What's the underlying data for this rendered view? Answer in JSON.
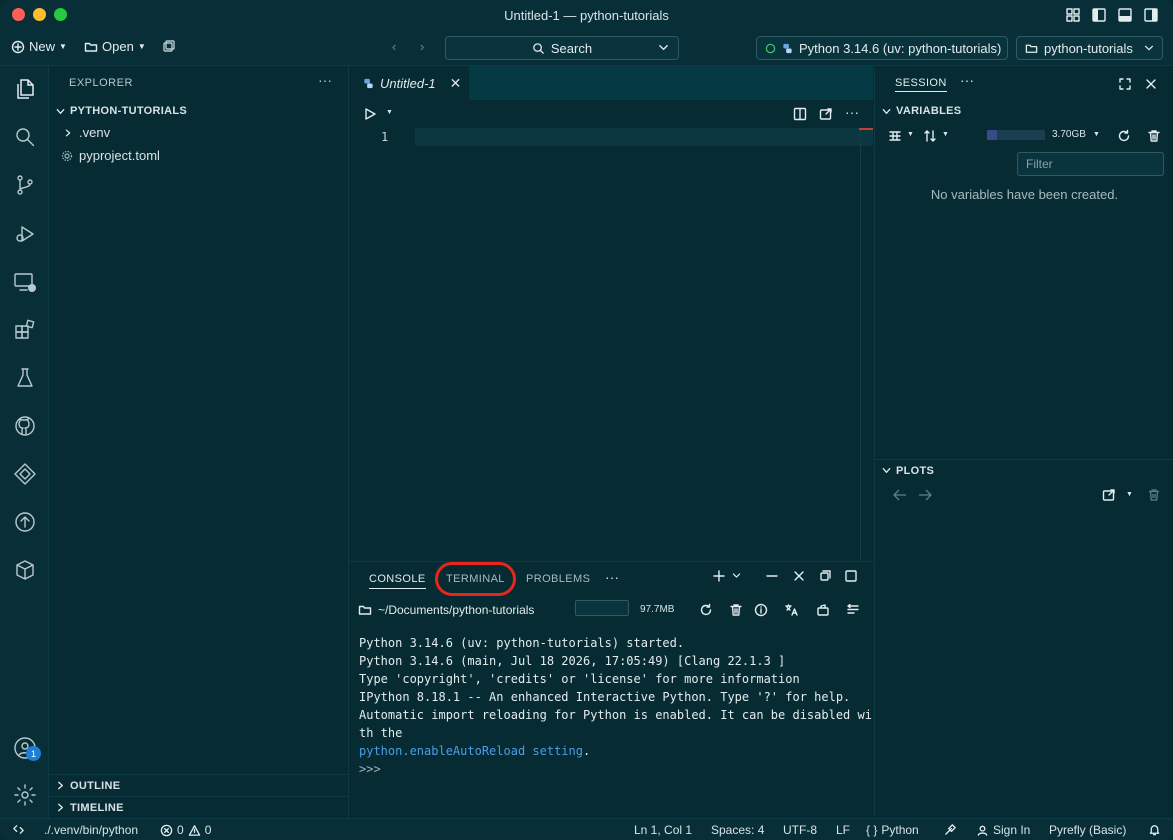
{
  "window": {
    "title": "Untitled-1 — python-tutorials"
  },
  "toolbar": {
    "new_label": "New",
    "open_label": "Open",
    "search_label": "Search",
    "interpreter_label": "Python 3.14.6 (uv: python-tutorials)",
    "project_label": "python-tutorials"
  },
  "explorer": {
    "header": "EXPLORER",
    "project_section": "PYTHON-TUTORIALS",
    "items": [
      {
        "label": ".venv",
        "icon": "chevron-right-icon"
      },
      {
        "label": "pyproject.toml",
        "icon": "gear-icon"
      }
    ],
    "outline_label": "OUTLINE",
    "timeline_label": "TIMELINE"
  },
  "editor": {
    "tab_label": "Untitled-1",
    "line_numbers": [
      "1"
    ]
  },
  "panel": {
    "tabs": [
      "CONSOLE",
      "TERMINAL",
      "PROBLEMS"
    ],
    "active_tab": "CONSOLE",
    "working_dir": "~/Documents/python-tutorials",
    "memory": "97.7MB",
    "output": [
      "Python 3.14.6 (uv: python-tutorials) started.",
      "Python 3.14.6 (main, Jul 18 2026, 17:05:49) [Clang 22.1.3 ]",
      "Type 'copyright', 'credits' or 'license' for more information",
      "IPython 8.18.1 -- An enhanced Interactive Python. Type '?' for help.",
      "Automatic import reloading for Python is enabled. It can be disabled wi",
      "th the"
    ],
    "link_text": "python.enableAutoReload setting",
    "link_suffix": ".",
    "prompt": ">>>"
  },
  "session": {
    "tab_label": "SESSION",
    "variables_label": "VARIABLES",
    "memory": "3.70GB",
    "memory_fraction": 0.18,
    "filter_placeholder": "Filter",
    "empty_message": "No variables have been created.",
    "plots_label": "PLOTS"
  },
  "statusbar": {
    "interpreter_path": "./.venv/bin/python",
    "errors": "0",
    "warnings": "0",
    "position": "Ln 1, Col 1",
    "spaces": "Spaces: 4",
    "encoding": "UTF-8",
    "eol": "LF",
    "language": "Python",
    "sign_in": "Sign In",
    "linter": "Pyrefly (Basic)"
  },
  "colors": {
    "background": "#062b33",
    "accent_blue": "#4c9de8",
    "highlight_red": "#e8261b"
  }
}
